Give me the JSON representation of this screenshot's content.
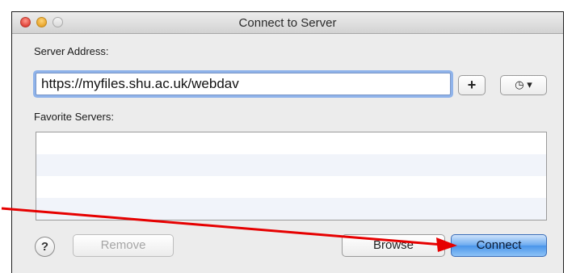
{
  "window": {
    "title": "Connect to Server"
  },
  "server_address": {
    "label": "Server Address:",
    "value": "https://myfiles.shu.ac.uk/webdav",
    "add_label": "+",
    "recent_label": "◷ ▾"
  },
  "favorites": {
    "label": "Favorite Servers:"
  },
  "footer": {
    "help_label": "?",
    "remove_label": "Remove",
    "browse_label": "Browse",
    "connect_label": "Connect"
  },
  "colors": {
    "annotation_arrow": "#e60000",
    "connect_accent": "#4a95ea"
  }
}
